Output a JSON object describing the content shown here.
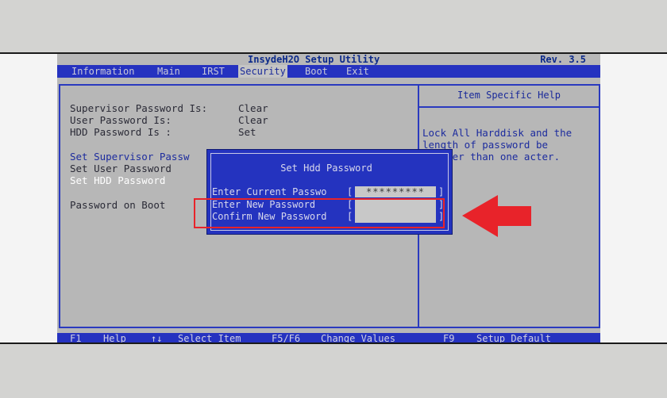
{
  "title": "InsydeH2O Setup Utility",
  "revision": "Rev. 3.5",
  "menu": [
    {
      "label": "Information",
      "active": false
    },
    {
      "label": "Main",
      "active": false
    },
    {
      "label": "IRST",
      "active": false
    },
    {
      "label": "Security",
      "active": true
    },
    {
      "label": "Boot",
      "active": false
    },
    {
      "label": "Exit",
      "active": false
    }
  ],
  "status": {
    "supervisor": {
      "label": "Supervisor Password Is:",
      "value": "Clear"
    },
    "user": {
      "label": "User Password Is:",
      "value": "Clear"
    },
    "hdd": {
      "label": "HDD Password Is :",
      "value": "Set"
    }
  },
  "options": {
    "set_supervisor": "Set Supervisor Passw",
    "set_user": "Set User Password",
    "set_hdd": "Set HDD Password",
    "password_on_boot": "Password on Boot"
  },
  "help": {
    "header": "Item Specific Help",
    "text": "Lock All Harddisk and the length of password be greater than one acter."
  },
  "dialog": {
    "title": "Set Hdd Password",
    "fields": [
      {
        "label": "Enter Current Passwo",
        "value": "*********"
      },
      {
        "label": "Enter New Password",
        "value": ""
      },
      {
        "label": "Confirm New Password",
        "value": ""
      }
    ]
  },
  "footer": [
    {
      "key": "F1",
      "action": "Help"
    },
    {
      "key": "↑↓",
      "action": "Select Item"
    },
    {
      "key": "F5/F6",
      "action": "Change Values"
    },
    {
      "key": "F9",
      "action": "Setup Default"
    }
  ],
  "annotation": {
    "highlight_color": "#e8232a",
    "arrow_color": "#e8232a"
  }
}
